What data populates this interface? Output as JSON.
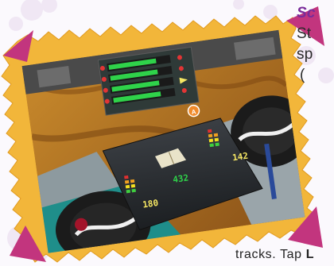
{
  "side_text": {
    "line1": "Sc",
    "line2": "St",
    "line3": "sp",
    "line4": "("
  },
  "bottom_text": {
    "prefix": "tracks. Tap ",
    "bold": "L"
  },
  "mixer": {
    "center_value": "432",
    "left_value": "180",
    "right_value": "142",
    "badge": "A"
  },
  "colors": {
    "accent_pink": "#c2357e",
    "frame_yellow": "#f2b63a",
    "panel_green": "#2fd24a",
    "lcd_yellow": "#f5e663"
  }
}
